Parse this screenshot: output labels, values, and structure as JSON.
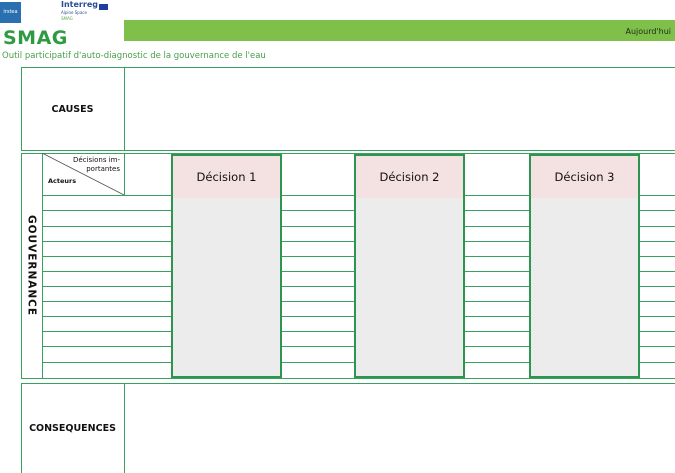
{
  "header": {
    "logo_left_text": "irstea",
    "interreg": "Interreg",
    "alpine_space": "Alpine Space",
    "smag_mini": "SMAG",
    "today_label": "Aujourd'hui",
    "app_name": "SMAG",
    "subtitle": "Outil participatif d'auto-diagnostic de la gouvernance de l'eau"
  },
  "causes": {
    "label": "CAUSES"
  },
  "gouvernance": {
    "label": "GOUVERNANCE",
    "header_decisions": "Décisions im-\nportantes",
    "header_acteurs": "Acteurs",
    "decisions": [
      "Décision 1",
      "Décision 2",
      "Décision 3"
    ]
  },
  "consequences": {
    "label": "CONSEQUENCES"
  },
  "colors": {
    "accent_green": "#7ec04a",
    "border_green": "#3aa060",
    "decision_pink": "#f4e1e1"
  }
}
